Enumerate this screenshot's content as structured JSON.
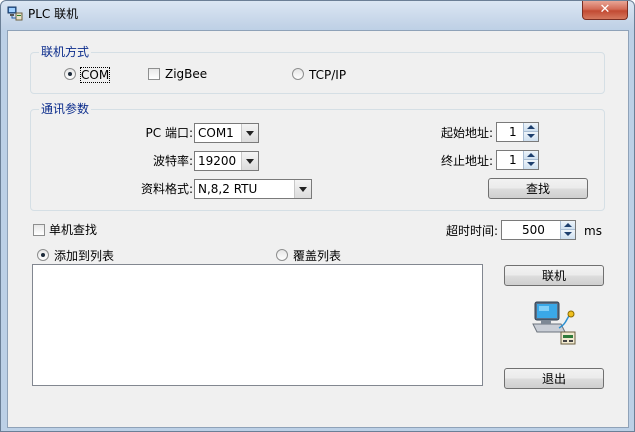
{
  "window": {
    "title": "PLC 联机",
    "close_label": "✕"
  },
  "connection_mode": {
    "label": "联机方式",
    "options": [
      {
        "label": "COM",
        "checked": true
      },
      {
        "label": "ZigBee",
        "checked": false
      },
      {
        "label": "TCP/IP",
        "checked": false
      }
    ]
  },
  "comm_params": {
    "label": "通讯参数",
    "pc_port": {
      "label": "PC 端口:",
      "value": "COM1"
    },
    "baud_rate": {
      "label": "波特率:",
      "value": "19200"
    },
    "data_format": {
      "label": "资料格式:",
      "value": "N,8,2 RTU"
    },
    "start_address": {
      "label": "起始地址:",
      "value": "1"
    },
    "end_address": {
      "label": "终止地址:",
      "value": "1"
    },
    "search_button": "查找"
  },
  "single_search": {
    "label": "单机查找",
    "checked": false
  },
  "timeout": {
    "label": "超时时间:",
    "value": "500",
    "unit": "ms"
  },
  "list_mode": {
    "options": [
      {
        "label": "添加到列表",
        "checked": true
      },
      {
        "label": "覆盖列表",
        "checked": false
      }
    ]
  },
  "buttons": {
    "connect": "联机",
    "exit": "退出"
  },
  "icons": {
    "app": "network-plc-icon",
    "connect_graphic": "computer-plc-connection-icon"
  }
}
